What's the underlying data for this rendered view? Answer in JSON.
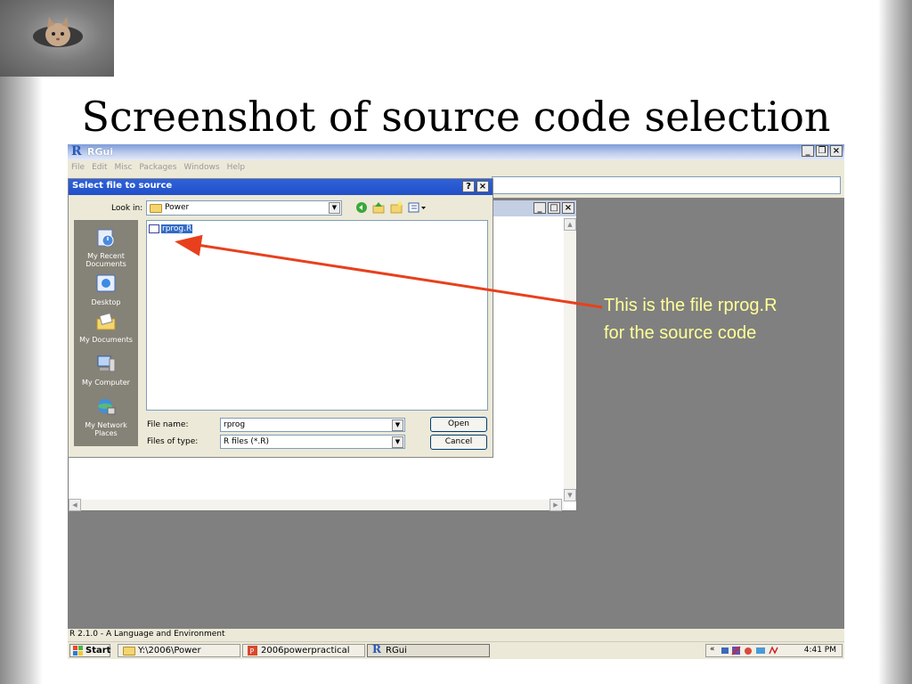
{
  "slide": {
    "title": "Screenshot of source code selection"
  },
  "rgui": {
    "title": "RGui",
    "menu": [
      "File",
      "Edit",
      "Misc",
      "Packages",
      "Windows",
      "Help"
    ],
    "status": "R 2.1.0 - A Language and Environment"
  },
  "dialog": {
    "title": "Select file to source",
    "look_in_label": "Look in:",
    "look_in_value": "Power",
    "places": [
      "My Recent Documents",
      "Desktop",
      "My Documents",
      "My Computer",
      "My Network Places"
    ],
    "files": [
      "rprog.R"
    ],
    "file_name_label": "File name:",
    "file_name_value": "rprog",
    "file_type_label": "Files of type:",
    "file_type_value": "R files (*.R)",
    "open_label": "Open",
    "cancel_label": "Cancel"
  },
  "taskbar": {
    "start_label": "Start",
    "tasks": [
      "Y:\\2006\\Power",
      "2006powerpractical",
      "RGui"
    ],
    "clock": "4:41 PM"
  },
  "annotation": {
    "text": "This is the file rprog.R for the source code"
  },
  "colors": {
    "annotation": "#ffff99",
    "arrow": "#e8401c",
    "selection": "#316ac5",
    "dialog_title": "#2150c8"
  }
}
